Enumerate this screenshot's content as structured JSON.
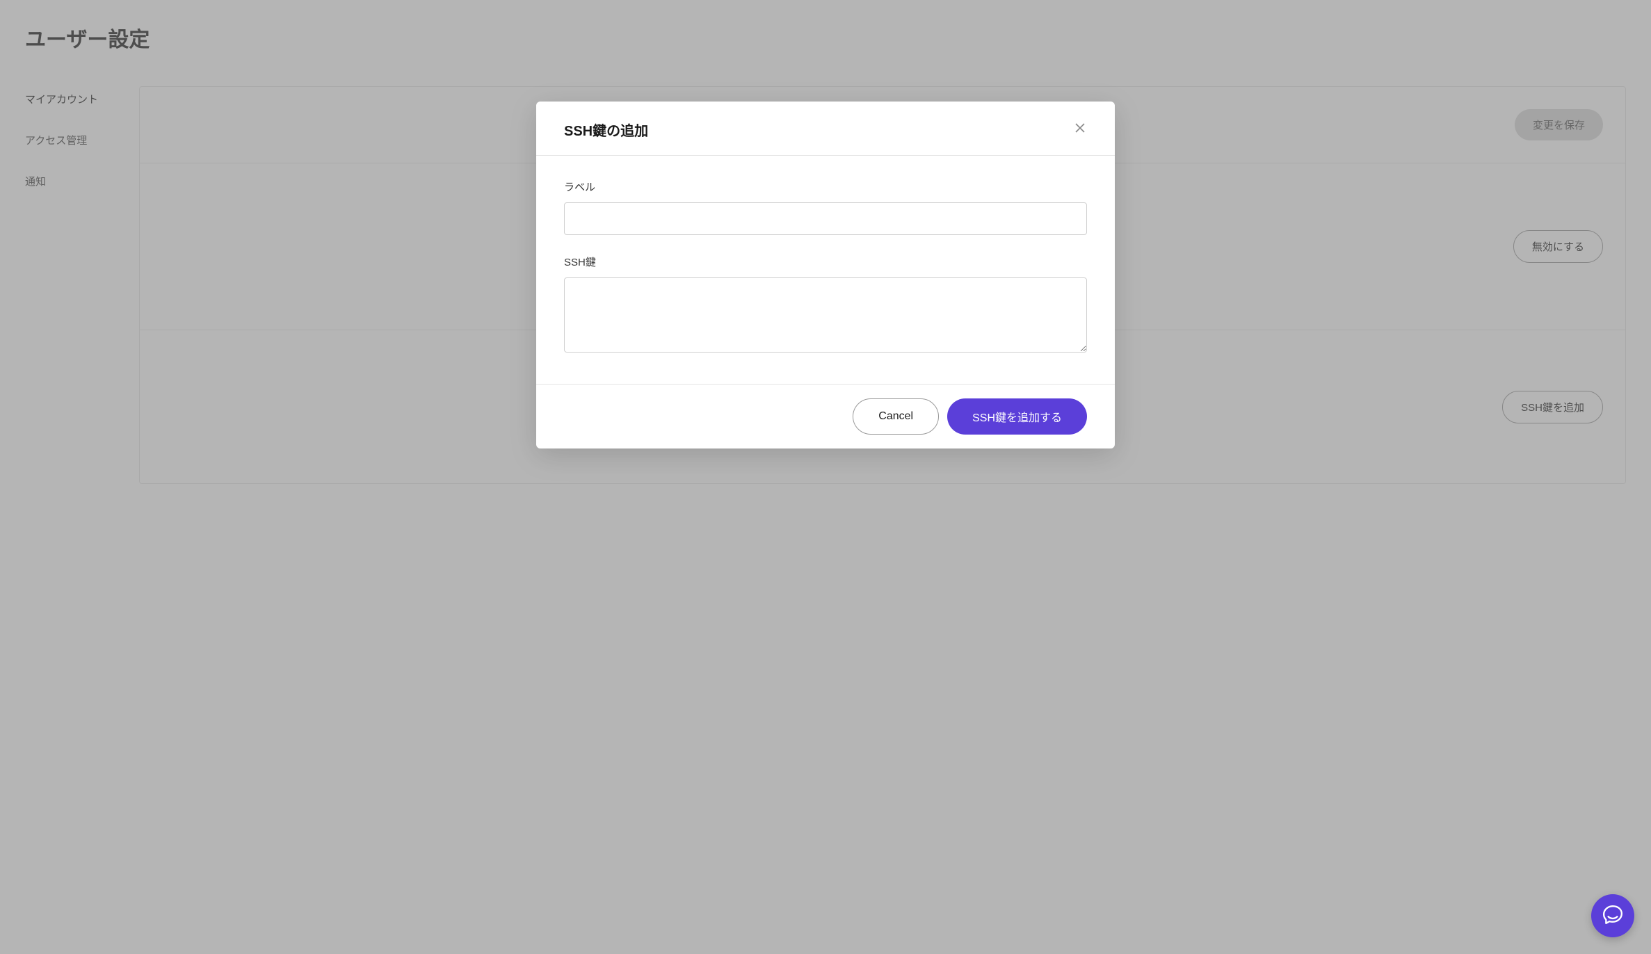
{
  "page": {
    "title": "ユーザー設定"
  },
  "sidebar": {
    "items": [
      {
        "label": "マイアカウント",
        "active": true
      },
      {
        "label": "アクセス管理",
        "active": false
      },
      {
        "label": "通知",
        "active": false
      }
    ]
  },
  "panel": {
    "save_button": "変更を保存",
    "disable_button": "無効にする",
    "add_ssh_button": "SSH鍵を追加"
  },
  "modal": {
    "title": "SSH鍵の追加",
    "label_label": "ラベル",
    "label_value": "",
    "sshkey_label": "SSH鍵",
    "sshkey_value": "",
    "cancel_button": "Cancel",
    "submit_button": "SSH鍵を追加する"
  }
}
